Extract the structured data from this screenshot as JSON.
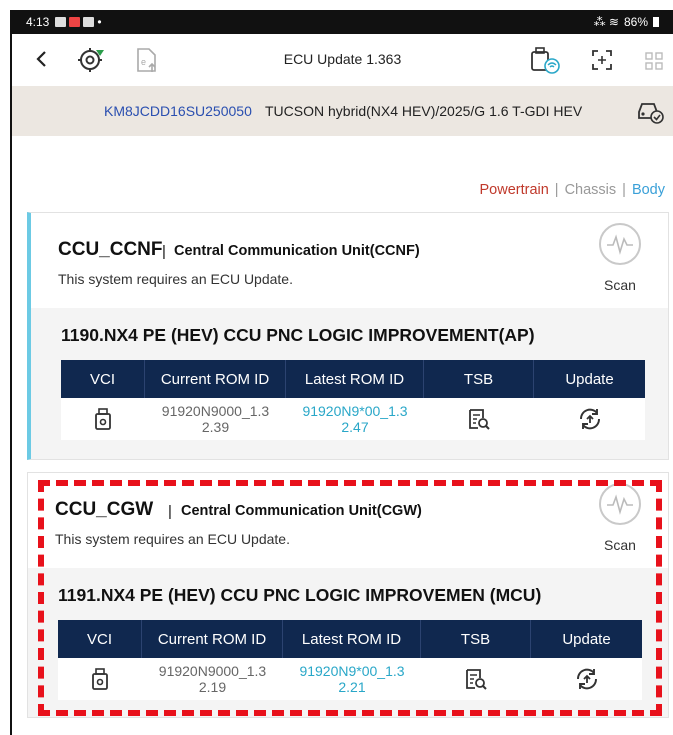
{
  "status_bar": {
    "time": "4:13",
    "signal": "⁂ ≋",
    "battery": "86%"
  },
  "app_bar": {
    "title": "ECU Update 1.363"
  },
  "vehicle": {
    "vin": "KM8JCDD16SU250050",
    "model": "TUCSON hybrid(NX4 HEV)/2025/G 1.6 T-GDI HEV"
  },
  "filters": {
    "powertrain": "Powertrain",
    "chassis": "Chassis",
    "body": "Body",
    "separator": "|"
  },
  "table_headers": {
    "vci": "VCI",
    "current": "Current ROM ID",
    "latest": "Latest ROM ID",
    "tsb": "TSB",
    "update": "Update"
  },
  "systems": [
    {
      "code": "CCU_CCNF",
      "separator": "|",
      "name": "Central Communication Unit(CCNF)",
      "requirement": "This system requires an ECU Update.",
      "scan_label": "Scan",
      "update_title": "1190.NX4 PE (HEV) CCU PNC LOGIC IMPROVEMENT(AP)",
      "current_rom_line1": "91920N9000_1.3",
      "current_rom_line2": "2.39",
      "latest_rom_line1": "91920N9*00_1.3",
      "latest_rom_line2": "2.47"
    },
    {
      "code": "CCU_CGW",
      "separator": "|",
      "name": "Central Communication Unit(CGW)",
      "requirement": "This system requires an ECU Update.",
      "scan_label": "Scan",
      "update_title": "1191.NX4 PE (HEV) CCU PNC LOGIC IMPROVEMEN (MCU)",
      "current_rom_line1": "91920N9000_1.3",
      "current_rom_line2": "2.19",
      "latest_rom_line1": "91920N9*00_1.3",
      "latest_rom_line2": "2.21"
    }
  ],
  "colors": {
    "header_navy": "#10284f",
    "latest_rom": "#29a7c8",
    "powertrain": "#c0392b",
    "body_link": "#3aa0d8",
    "highlight": "#e8111b"
  }
}
